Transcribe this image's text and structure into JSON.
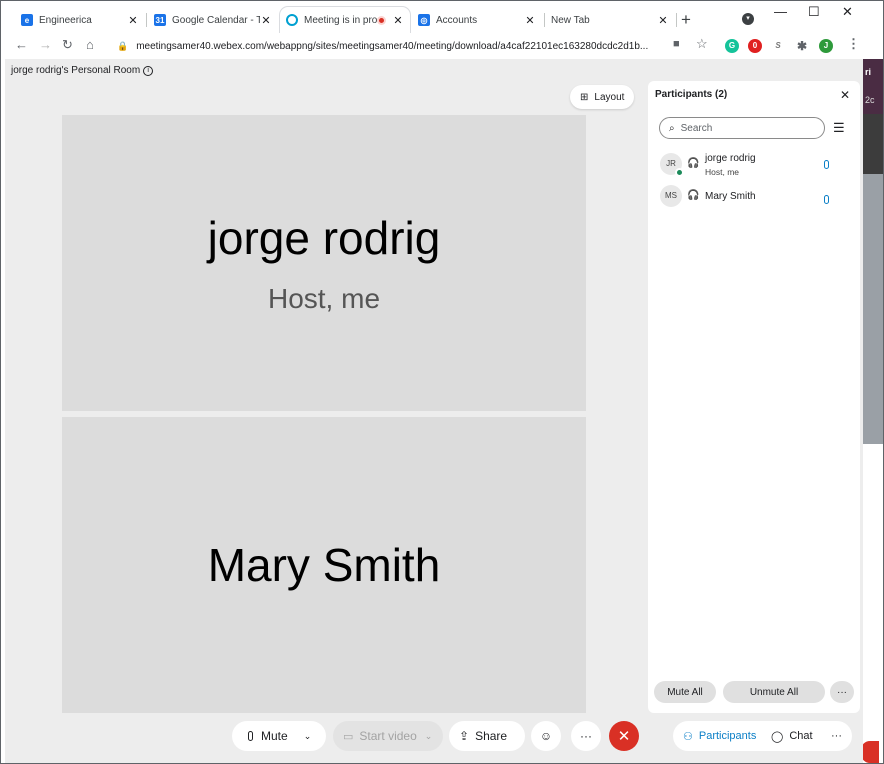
{
  "browser": {
    "tabs": [
      {
        "title": "Engineerica",
        "icon": "engineerica-icon",
        "color": "#1a73e8"
      },
      {
        "title": "Google Calendar - Tu",
        "icon": "calendar-icon",
        "color": "#1a73e8"
      },
      {
        "title": "Meeting is in proc",
        "icon": "webex-icon",
        "color": "#00a0d1"
      },
      {
        "title": "Accounts",
        "icon": "accounts-icon",
        "color": "#1a73e8"
      },
      {
        "title": "New Tab",
        "icon": "",
        "color": ""
      }
    ],
    "url": "meetingsamer40.webex.com/webappng/sites/meetingsamer40/meeting/download/a4caf22101ec163280dcdc2d1b...",
    "profile_initial": "J"
  },
  "meeting": {
    "room_title": "jorge rodrig's Personal Room",
    "layout_label": "Layout",
    "tiles": [
      {
        "name": "jorge rodrig",
        "subtitle": "Host, me"
      },
      {
        "name": "Mary Smith",
        "subtitle": ""
      }
    ]
  },
  "participants_panel": {
    "title": "Participants (2)",
    "search_placeholder": "Search",
    "participants": [
      {
        "initials": "JR",
        "name": "jorge rodrig",
        "role": "Host, me"
      },
      {
        "initials": "MS",
        "name": "Mary Smith",
        "role": ""
      }
    ],
    "mute_all": "Mute All",
    "unmute_all": "Unmute All",
    "more": "···"
  },
  "controls": {
    "mute": "Mute",
    "start_video": "Start video",
    "share": "Share",
    "more": "···",
    "participants": "Participants",
    "chat": "Chat",
    "right_more": "···"
  },
  "colors": {
    "accent": "#0b7fc7",
    "end_call": "#d93025",
    "online": "#1b8a5a"
  },
  "side_fragment": "2c",
  "side_fragment2": "ri"
}
